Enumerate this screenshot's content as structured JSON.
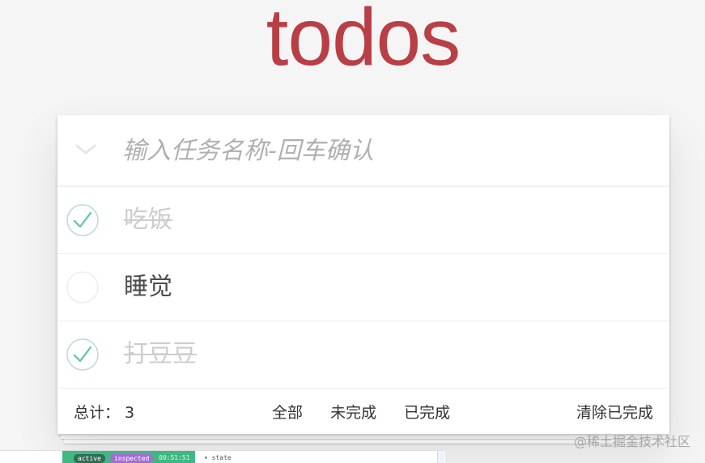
{
  "app": {
    "title": "todos"
  },
  "new_todo": {
    "placeholder": "输入任务名称-回车确认",
    "value": ""
  },
  "todos": [
    {
      "label": "吃饭",
      "completed": true
    },
    {
      "label": "睡觉",
      "completed": false
    },
    {
      "label": "打豆豆",
      "completed": true
    }
  ],
  "footer": {
    "count_label": "总计：",
    "count_value": "3",
    "filters": [
      "全部",
      "未完成",
      "已完成"
    ],
    "clear_label": "清除已完成"
  },
  "devtools": {
    "badge_active": "active",
    "badge_inspected": "inspected",
    "time": "00:51:51",
    "state_label": "▾ state"
  },
  "watermark": "@稀土掘金技术社区",
  "colors": {
    "title": "#b83f45",
    "check": "#5dc2af",
    "completed_text": "#cdcdcd"
  }
}
